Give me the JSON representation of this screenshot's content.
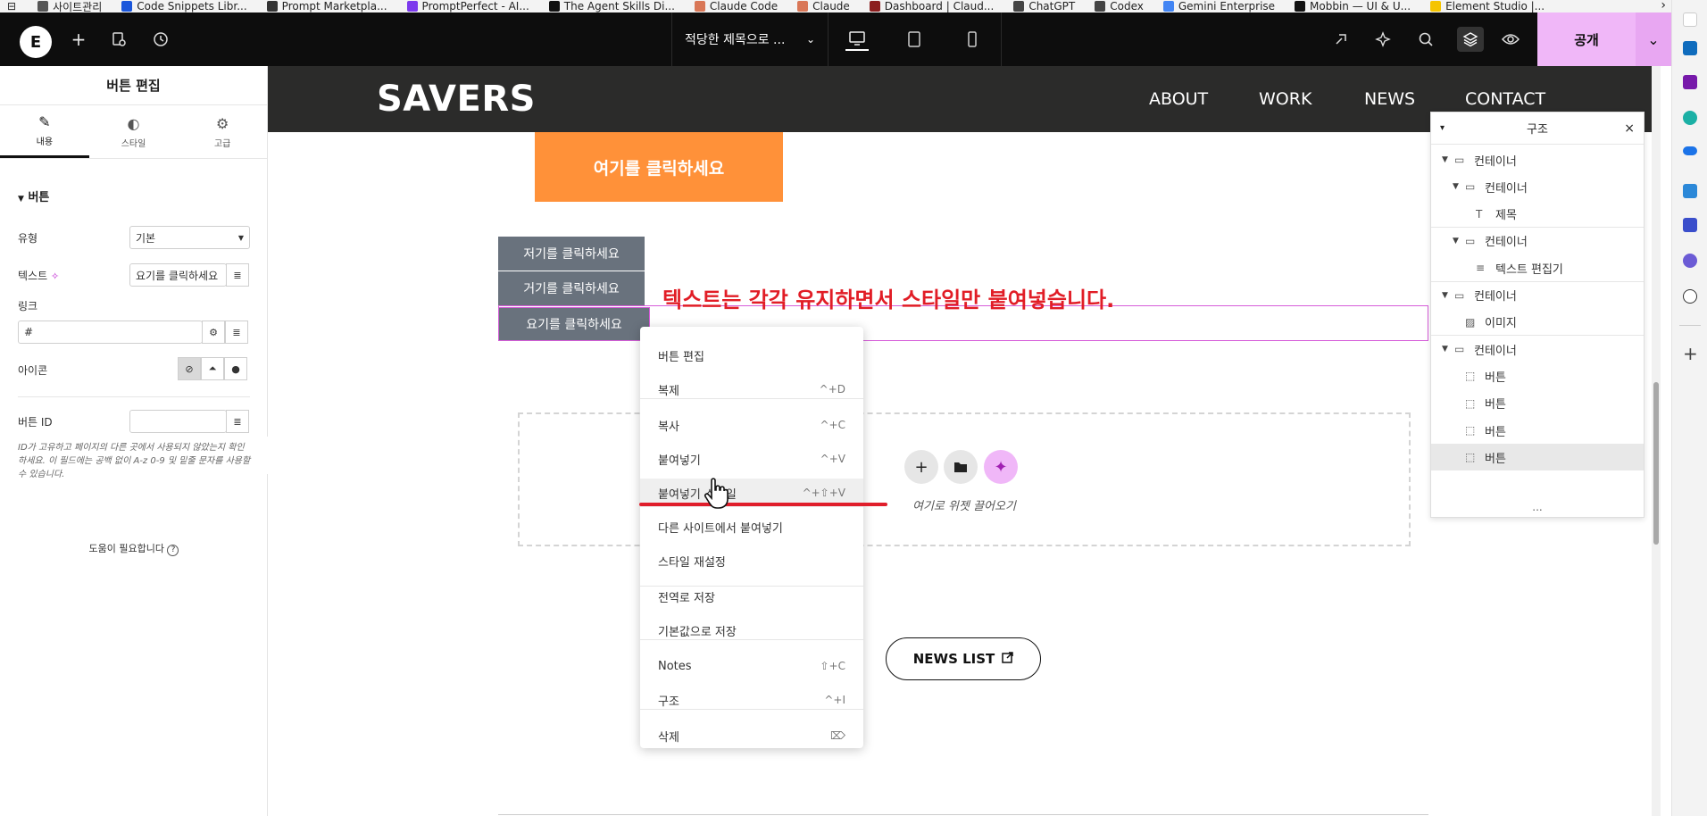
{
  "bookmarks": {
    "items": [
      {
        "label": "사이트관리",
        "icon": "folder-icon",
        "color": "#555555"
      },
      {
        "label": "Code Snippets Libr...",
        "icon": "code-icon",
        "color": "#1a56db"
      },
      {
        "label": "Prompt Marketpla...",
        "icon": "prompt-icon",
        "color": "#333333"
      },
      {
        "label": "PromptPerfect - AI...",
        "icon": "promptperfect-icon",
        "color": "#7c3aed"
      },
      {
        "label": "The Agent Skills Di...",
        "icon": "agent-icon",
        "color": "#111111"
      },
      {
        "label": "Claude Code",
        "icon": "claude-icon",
        "color": "#d97757"
      },
      {
        "label": "Claude",
        "icon": "claude-icon",
        "color": "#d97757"
      },
      {
        "label": "Dashboard | Claud...",
        "icon": "dashboard-icon",
        "color": "#8b1e1e"
      },
      {
        "label": "ChatGPT",
        "icon": "chatgpt-icon",
        "color": "#444444"
      },
      {
        "label": "Codex",
        "icon": "codex-icon",
        "color": "#444444"
      },
      {
        "label": "Gemini Enterprise",
        "icon": "gemini-icon",
        "color": "#4285f4"
      },
      {
        "label": "Mobbin — UI & U...",
        "icon": "mobbin-icon",
        "color": "#111111"
      },
      {
        "label": "Element Studio |...",
        "icon": "element-icon",
        "color": "#f5c400"
      }
    ]
  },
  "topbar": {
    "logo": "E",
    "page_title": "적당한 제목으로 ...",
    "publish_label": "공개"
  },
  "panel": {
    "title": "버튼 편집",
    "tabs": [
      {
        "label": "내용",
        "icon": "pencil-icon",
        "glyph": "✎"
      },
      {
        "label": "스타일",
        "icon": "half-circle-icon",
        "glyph": "◐"
      },
      {
        "label": "고급",
        "icon": "gear-icon",
        "glyph": "⚙"
      }
    ],
    "section": "버튼",
    "type_label": "유형",
    "type_value": "기본",
    "text_label": "텍스트",
    "text_value": "요기를 클릭하세요",
    "link_label": "링크",
    "link_value": "#",
    "icon_label": "아이콘",
    "button_id_label": "버튼 ID",
    "button_id_value": "",
    "hint": "ID가 고유하고 페이지의 다른 곳에서 사용되지 않았는지 확인하세요. 이 필드에는 공백 없이 A-z 0-9 및 밑줄 문자를 사용할 수 있습니다.",
    "help": "도움이 필요합니다"
  },
  "site": {
    "brand": "SAVERS",
    "nav": [
      "ABOUT",
      "WORK",
      "NEWS",
      "CONTACT"
    ],
    "orange_button": "여기를 클릭하세요",
    "gray_buttons": [
      "저기를 클릭하세요",
      "거기를 클릭하세요",
      "요기를 클릭하세요"
    ],
    "annotation": "텍스트는 각각 유지하면서 스타일만 붙여넣습니다.",
    "drop_text": "여기로 위젯 끌어오기",
    "news_list": "NEWS LIST",
    "accent_color": "#f0b7f8",
    "orange_color": "#ff9139",
    "annotation_color": "#e11d26"
  },
  "structure": {
    "title": "구조",
    "rows": [
      {
        "label": "컨테이너",
        "icon": "container-icon",
        "level": 0,
        "arrow": true
      },
      {
        "label": "컨테이너",
        "icon": "container-icon",
        "level": 1,
        "arrow": true
      },
      {
        "label": "제목",
        "icon": "heading-icon",
        "level": 2,
        "arrow": false
      },
      {
        "label": "컨테이너",
        "icon": "container-icon",
        "level": 1,
        "arrow": true
      },
      {
        "label": "텍스트 편집기",
        "icon": "text-editor-icon",
        "level": 2,
        "arrow": false
      },
      {
        "label": "컨테이너",
        "icon": "container-icon",
        "level": 0,
        "arrow": true
      },
      {
        "label": "이미지",
        "icon": "image-icon",
        "level": 1,
        "arrow": false
      },
      {
        "label": "컨테이너",
        "icon": "container-icon",
        "level": 0,
        "arrow": true
      },
      {
        "label": "버튼",
        "icon": "button-icon",
        "level": 1,
        "arrow": false
      },
      {
        "label": "버튼",
        "icon": "button-icon",
        "level": 1,
        "arrow": false
      },
      {
        "label": "버튼",
        "icon": "button-icon",
        "level": 1,
        "arrow": false
      },
      {
        "label": "버튼",
        "icon": "button-icon",
        "level": 1,
        "arrow": false,
        "selected": true
      }
    ],
    "more": "..."
  },
  "context_menu": {
    "items": [
      {
        "label": "버튼 편집",
        "shortcut": ""
      },
      {
        "label": "복제",
        "shortcut": "^+D"
      },
      {
        "label": "복사",
        "shortcut": "^+C"
      },
      {
        "label": "붙여넣기",
        "shortcut": "^+V"
      },
      {
        "label": "붙여넣기 스타일",
        "shortcut": "^+⇧+V",
        "hover": true
      },
      {
        "label": "다른 사이트에서 붙여넣기",
        "shortcut": ""
      },
      {
        "label": "스타일 재설정",
        "shortcut": ""
      },
      {
        "label": "전역로 저장",
        "shortcut": ""
      },
      {
        "label": "기본값으로 저장",
        "shortcut": ""
      },
      {
        "label": "Notes",
        "shortcut": "⇧+C"
      },
      {
        "label": "구조",
        "shortcut": "^+I"
      },
      {
        "label": "삭제",
        "shortcut": "⌦"
      }
    ]
  }
}
